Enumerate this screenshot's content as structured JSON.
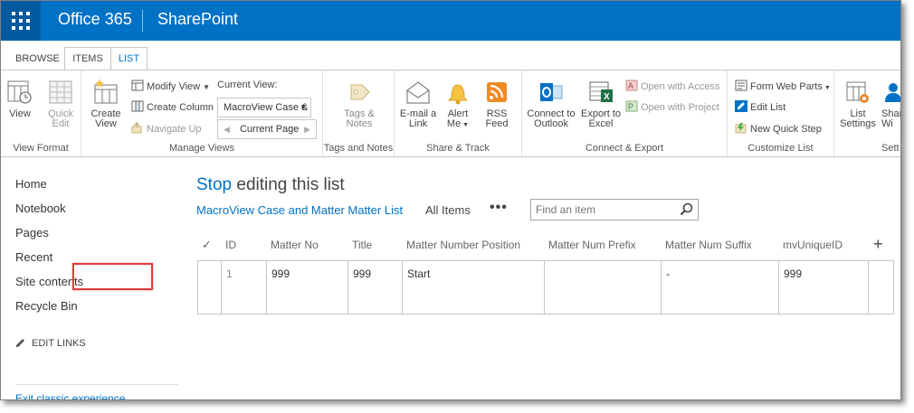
{
  "suite": {
    "brand": "Office 365",
    "app": "SharePoint"
  },
  "tabs": [
    "BROWSE",
    "ITEMS",
    "LIST"
  ],
  "ribbon": {
    "view_format": {
      "label": "View Format",
      "view": "View",
      "quick_edit_1": "Quick",
      "quick_edit_2": "Edit"
    },
    "manage_views": {
      "label": "Manage Views",
      "create_view_1": "Create",
      "create_view_2": "View",
      "modify_view": "Modify View",
      "create_column": "Create Column",
      "navigate_up": "Navigate Up",
      "current_view_label": "Current View:",
      "current_view_value": "MacroView Case &",
      "current_page": "Current Page"
    },
    "tags_notes": {
      "label": "Tags and Notes",
      "btn_1": "Tags &",
      "btn_2": "Notes"
    },
    "share_track": {
      "label": "Share & Track",
      "email_1": "E-mail a",
      "email_2": "Link",
      "alert_1": "Alert",
      "alert_2": "Me",
      "rss_1": "RSS",
      "rss_2": "Feed"
    },
    "connect_export": {
      "label": "Connect & Export",
      "outlook_1": "Connect to",
      "outlook_2": "Outlook",
      "excel_1": "Export to",
      "excel_2": "Excel",
      "access": "Open with Access",
      "project": "Open with Project"
    },
    "customize_list": {
      "label": "Customize List",
      "form_web_parts": "Form Web Parts",
      "edit_list": "Edit List",
      "new_quick_step": "New Quick Step"
    },
    "settings": {
      "label": "Sett",
      "list_settings_1": "List",
      "list_settings_2": "Settings",
      "share_1": "Shar",
      "share_2": "Wi"
    }
  },
  "leftnav": {
    "items": [
      "Home",
      "Notebook",
      "Pages",
      "Recent",
      "Site contents",
      "Recycle Bin"
    ],
    "edit_links": "EDIT LINKS",
    "exit": "Exit classic experience"
  },
  "main": {
    "title_stop": "Stop",
    "title_rest": " editing this list",
    "view_list": "MacroView Case and Matter Matter List",
    "view_all": "All Items",
    "view_more": "•••",
    "search_placeholder": "Find an item"
  },
  "grid": {
    "headers": [
      "ID",
      "Matter No",
      "Title",
      "Matter Number Position",
      "Matter Num Prefix",
      "Matter Num Suffix",
      "mvUniqueID"
    ],
    "rows": [
      [
        "1",
        "999",
        "999",
        "Start",
        "",
        "-",
        "999"
      ]
    ]
  },
  "colors": {
    "suitebar": "#0072c6",
    "waffle": "#005a9e",
    "accent": "#0072c6",
    "selection": "#e03c3c"
  }
}
